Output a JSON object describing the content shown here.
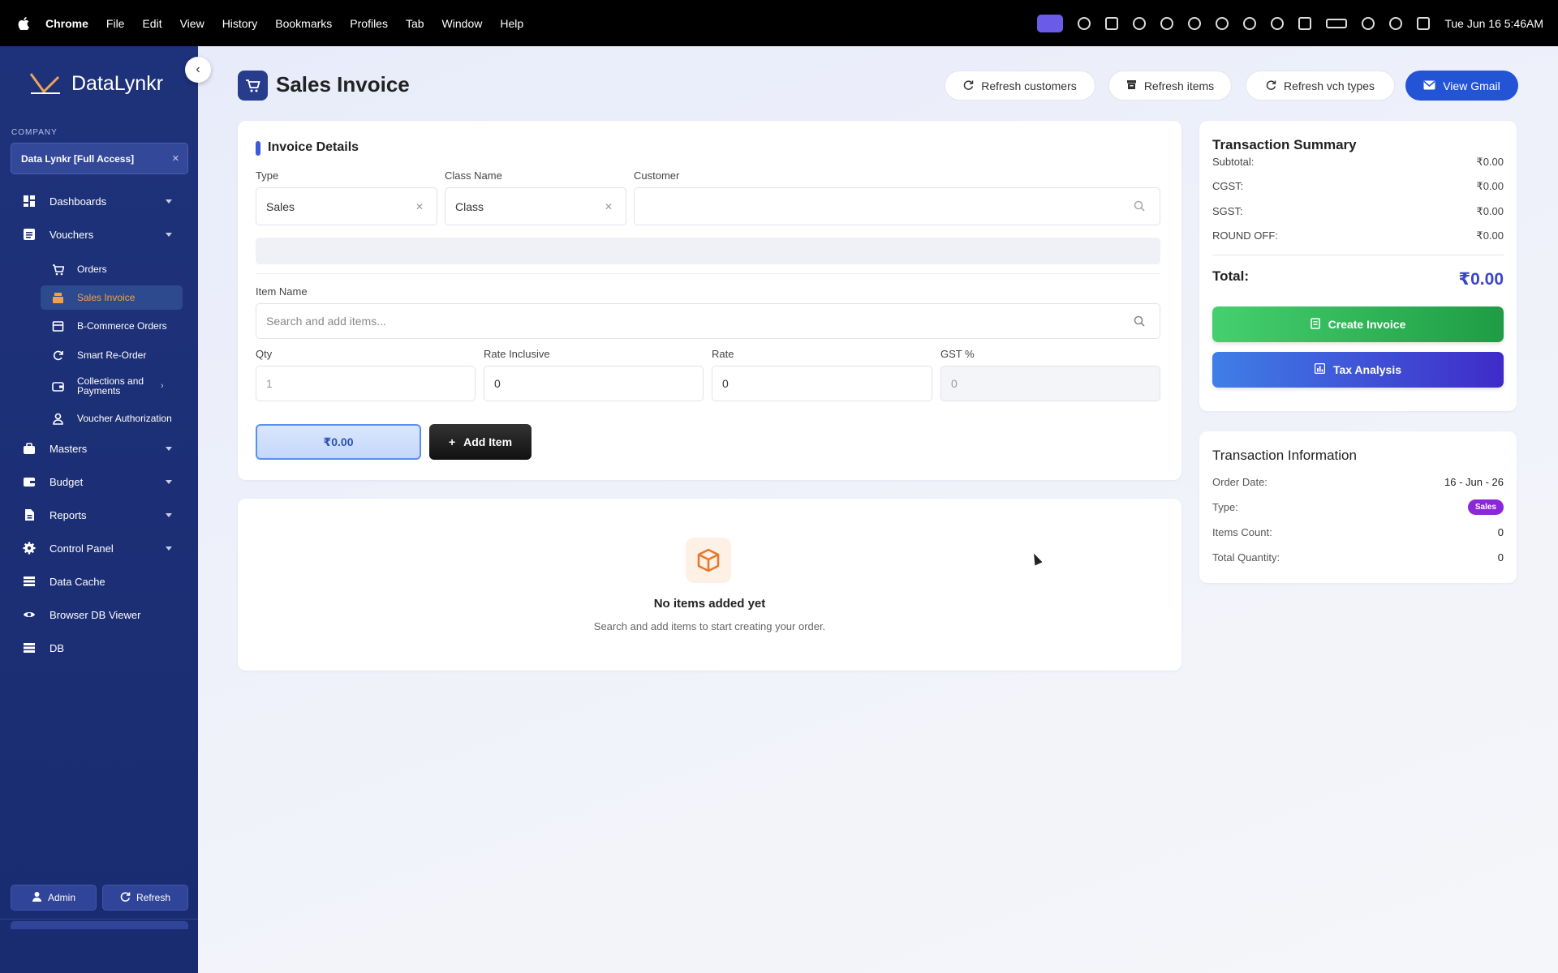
{
  "menubar": {
    "items": [
      "Chrome",
      "File",
      "Edit",
      "View",
      "History",
      "Bookmarks",
      "Profiles",
      "Tab",
      "Window",
      "Help"
    ],
    "clock": "Tue Jun 16  5:46AM"
  },
  "sidebar": {
    "brand": "DataLynkr",
    "company_label": "COMPANY",
    "company_value": "Data Lynkr [Full Access]",
    "nav": {
      "dashboards": "Dashboards",
      "vouchers": "Vouchers",
      "orders": "Orders",
      "sales_invoice": "Sales Invoice",
      "bcommerce": "B-Commerce Orders",
      "smart_reorder": "Smart Re-Order",
      "collections_l1": "Collections and",
      "collections_l2": "Payments",
      "voucher_auth": "Voucher Authorization",
      "masters": "Masters",
      "budget": "Budget",
      "reports": "Reports",
      "control_panel": "Control Panel",
      "data_cache": "Data Cache",
      "browser_db": "Browser DB Viewer",
      "db": "DB"
    },
    "admin_label": "Admin",
    "refresh_label": "Refresh"
  },
  "header": {
    "title": "Sales Invoice",
    "refresh_customers": "Refresh customers",
    "refresh_items": "Refresh items",
    "refresh_vch": "Refresh vch types",
    "view_gmail": "View Gmail"
  },
  "invoice": {
    "section_title": "Invoice Details",
    "type_label": "Type",
    "type_value": "Sales",
    "class_label": "Class Name",
    "class_value": "Class",
    "customer_label": "Customer",
    "customer_value": "",
    "item_label": "Item Name",
    "item_placeholder": "Search and add items...",
    "qty_label": "Qty",
    "qty_value": "1",
    "rate_incl_label": "Rate Inclusive",
    "rate_incl_value": "0",
    "rate_label": "Rate",
    "rate_value": "0",
    "gst_label": "GST %",
    "gst_value": "0",
    "line_total": "₹0.00",
    "add_item": "Add Item"
  },
  "empty_state": {
    "title": "No items added yet",
    "subtitle": "Search and add items to start creating your order."
  },
  "summary": {
    "title": "Transaction Summary",
    "subtotal_label": "Subtotal:",
    "subtotal": "₹0.00",
    "cgst_label": "CGST:",
    "cgst": "₹0.00",
    "sgst_label": "SGST:",
    "sgst": "₹0.00",
    "round_label": "ROUND OFF:",
    "round": "₹0.00",
    "total_label": "Total:",
    "total": "₹0.00",
    "create_invoice": "Create Invoice",
    "tax_analysis": "Tax Analysis"
  },
  "info": {
    "title": "Transaction Information",
    "order_date_label": "Order Date:",
    "order_date": "16 - Jun - 26",
    "type_label": "Type:",
    "type": "Sales",
    "items_count_label": "Items Count:",
    "items_count": "0",
    "total_qty_label": "Total Quantity:",
    "total_qty": "0"
  },
  "colors": {
    "sidebar": "#1e327b",
    "accent": "#2454d6",
    "active_item": "#f1a14c",
    "create_green": "#1f9c45",
    "tax_purple": "#3f2bc8",
    "badge": "#8b27d8"
  }
}
